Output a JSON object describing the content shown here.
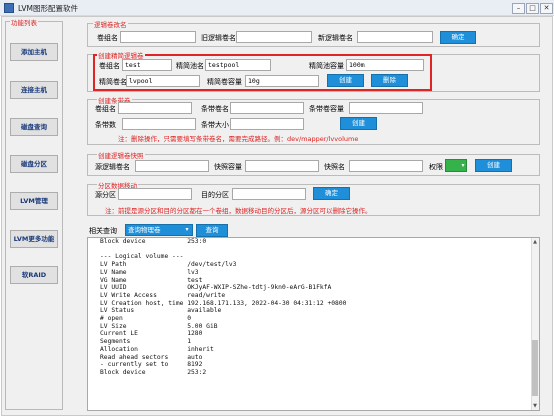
{
  "window": {
    "title": "LVM图形配置软件",
    "min_glyph": "–",
    "max_glyph": "□",
    "close_glyph": "✕"
  },
  "sidebar": {
    "title": "功能列表",
    "items": [
      {
        "label": "添加主机"
      },
      {
        "label": "连接主机"
      },
      {
        "label": "磁盘查询"
      },
      {
        "label": "磁盘分区"
      },
      {
        "label": "LVM管理"
      },
      {
        "label": "LVM更多功能"
      },
      {
        "label": "软RAID"
      }
    ]
  },
  "rename_lv": {
    "title": "逻辑卷改名",
    "vg_label": "卷组名",
    "vg_value": "",
    "old_label": "旧逻辑卷名",
    "old_value": "",
    "new_label": "新逻辑卷名",
    "new_value": "",
    "confirm_label": "确定"
  },
  "thin_lv": {
    "title": "创建精简逻辑卷",
    "vg_label": "卷组名",
    "vg_value": "test",
    "pool_label": "精简池名",
    "pool_value": "testpool",
    "pool_size_label": "精简池容量",
    "pool_size_value": "100m",
    "lv_label": "精简卷名",
    "lv_value": "lvpool",
    "lv_size_label": "精简卷容量",
    "lv_size_value": "10g",
    "create_label": "创建",
    "delete_label": "删除"
  },
  "striped_lv": {
    "title": "创建条带卷",
    "vg_label": "卷组名",
    "vg_value": "",
    "name_label": "条带卷名",
    "name_value": "",
    "size_label": "条带卷容量",
    "size_value": "",
    "count_label": "条带数",
    "count_value": "",
    "stripe_size_label": "条带大小",
    "stripe_size_value": "",
    "create_label": "创建",
    "note": "注：删除操作，只需要填写条带卷名，需要完成路径。例：dev/mapper/lvvolume"
  },
  "snapshot": {
    "title": "创建逻辑卷快照",
    "source_label": "源逻辑卷名",
    "source_value": "",
    "snap_cap_label": "快照容量",
    "snap_cap_value": "",
    "snap_name_label": "快照名",
    "snap_name_value": "",
    "perm_label": "权限",
    "perm_value": "",
    "create_label": "创建"
  },
  "migrate": {
    "title": "分区数据移动",
    "source_label": "源分区",
    "source_value": "",
    "target_label": "目的分区",
    "target_value": "",
    "confirm_label": "确定",
    "note": "注：前提是源分区和目的分区都在一个卷组，数据移动目的分区后，源分区可以删除它操作。"
  },
  "query": {
    "label": "相关查询",
    "selected": "查询物理卷",
    "arrow_glyph": "▾",
    "button_label": "查询"
  },
  "output": {
    "scroll_up": "▲",
    "scroll_down": "▼",
    "text": "Block device           253:0\n\n--- Logical volume ---\nLV Path                /dev/test/lv3\nLV Name                lv3\nVG Name                test\nLV UUID                OKJyAF-WXIP-SZhe-tdtj-9kn0-eArG-B1FkfA\nLV Write Access        read/write\nLV Creation host, time 192.168.171.133, 2022-04-30 04:31:12 +0800\nLV Status              available\n# open                 0\nLV Size                5.00 GiB\nCurrent LE             1280\nSegments               1\nAllocation             inherit\nRead ahead sectors     auto\n- currently set to     8192\nBlock device           253:2"
  }
}
